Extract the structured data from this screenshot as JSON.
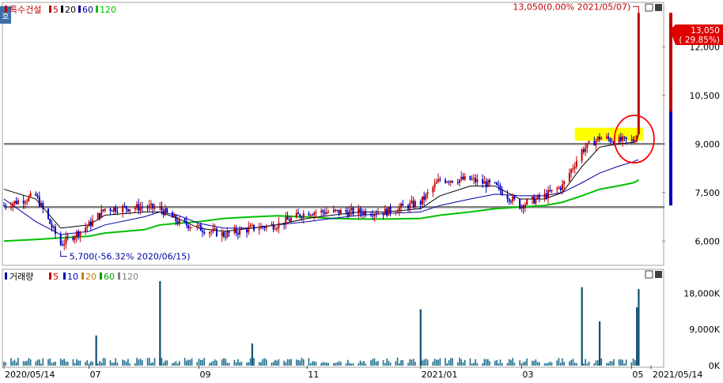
{
  "chart_data": [
    {
      "type": "candlestick",
      "title": "특수건설",
      "legend": [
        {
          "label": "특수건설",
          "color": "#c00000"
        },
        {
          "label": "5",
          "color": "#c00000"
        },
        {
          "label": "20",
          "color": "#000000"
        },
        {
          "label": "60",
          "color": "#0000a0"
        },
        {
          "label": "120",
          "color": "#00a000"
        }
      ],
      "ylim": [
        5300,
        13300
      ],
      "y_ticks": [
        6000,
        7500,
        9000,
        10500,
        12000
      ],
      "y_tick_labels": [
        "6,000",
        "7,500",
        "9,000",
        "10,500",
        "12,000"
      ],
      "horizontal_lines": [
        9000,
        7050
      ],
      "price_series": {
        "dates": [
          "2020-05-14",
          "2020-06-01",
          "2020-06-15",
          "2020-07-01",
          "2020-07-10",
          "2020-08-01",
          "2020-08-10",
          "2020-08-20",
          "2020-09-01",
          "2020-09-15",
          "2020-10-01",
          "2020-10-15",
          "2020-11-01",
          "2020-11-15",
          "2020-12-01",
          "2020-12-15",
          "2021-01-04",
          "2021-01-15",
          "2021-02-01",
          "2021-02-15",
          "2021-03-01",
          "2021-03-15",
          "2021-03-25",
          "2021-04-05",
          "2021-04-15",
          "2021-04-25",
          "2021-05-04",
          "2021-05-06",
          "2021-05-07"
        ],
        "close": [
          7100,
          7400,
          5900,
          6500,
          7000,
          7050,
          7000,
          6600,
          6400,
          6200,
          6400,
          6500,
          6900,
          6900,
          6900,
          6900,
          7200,
          7900,
          7900,
          7700,
          7100,
          7400,
          7700,
          8800,
          9200,
          9100,
          9100,
          9300,
          13050
        ]
      },
      "ma20": [
        7600,
        7300,
        6400,
        6500,
        6800,
        6900,
        6900,
        6700,
        6400,
        6300,
        6400,
        6500,
        6700,
        6800,
        6900,
        6900,
        7000,
        7400,
        7700,
        7700,
        7300,
        7300,
        7500,
        8300,
        8900,
        9000,
        9050,
        9100,
        9300
      ],
      "ma60": [
        7300,
        6600,
        6200,
        6300,
        6500,
        6750,
        6900,
        6800,
        6550,
        6400,
        6400,
        6500,
        6600,
        6700,
        6800,
        6850,
        6900,
        7100,
        7300,
        7450,
        7400,
        7400,
        7500,
        7800,
        8100,
        8300,
        8450,
        8500,
        8500
      ],
      "ma120": [
        6000,
        6050,
        6100,
        6150,
        6250,
        6350,
        6500,
        6550,
        6600,
        6700,
        6750,
        6780,
        6750,
        6700,
        6680,
        6680,
        6700,
        6800,
        6900,
        7000,
        7050,
        7100,
        7200,
        7400,
        7600,
        7700,
        7800,
        7850,
        7900
      ],
      "annotations": [
        {
          "text": "13,050(0.00% 2021/05/07)",
          "value": 13050,
          "date": "2021-05-07"
        },
        {
          "text": "5,700(-56.32% 2020/06/15)",
          "value": 5700,
          "date": "2020-06-15"
        }
      ],
      "last_price_badge": {
        "price": "13,050",
        "change": "( 29.85%)"
      },
      "highlight": {
        "type": "box",
        "from": "2021-04-01",
        "to": "2021-05-07",
        "ylow": 9100,
        "yhigh": 9500,
        "color": "#ffff00"
      },
      "callout": {
        "type": "circle",
        "around": "2021-05-01",
        "color": "#ff0000"
      }
    },
    {
      "type": "bar",
      "title": "거래량",
      "legend": [
        {
          "label": "거래량",
          "color": "#000000"
        },
        {
          "label": "5",
          "color": "#c00000"
        },
        {
          "label": "10",
          "color": "#0000c0"
        },
        {
          "label": "20",
          "color": "#c08000"
        },
        {
          "label": "60",
          "color": "#00a000"
        },
        {
          "label": "120",
          "color": "#808080"
        }
      ],
      "ylim": [
        0,
        21000
      ],
      "y_ticks": [
        0,
        9000,
        18000
      ],
      "y_tick_labels": [
        "0K",
        "9,000K",
        "18,000K"
      ],
      "spikes": [
        {
          "date": "2020-07-05",
          "value": 7500
        },
        {
          "date": "2020-08-10",
          "value": 22000
        },
        {
          "date": "2020-10-01",
          "value": 5500
        },
        {
          "date": "2021-01-04",
          "value": 14000
        },
        {
          "date": "2021-04-05",
          "value": 19500
        },
        {
          "date": "2021-04-15",
          "value": 11000
        },
        {
          "date": "2021-05-06",
          "value": 14500
        },
        {
          "date": "2021-05-07",
          "value": 19000
        }
      ],
      "baseline_volume": 1000
    }
  ],
  "x_axis": {
    "ticks": [
      "2020/05/14",
      "07",
      "09",
      "11",
      "2021/01",
      "03",
      "05",
      "2021/05/14"
    ],
    "tick_dates": [
      "2020-05-14",
      "2020-07-01",
      "2020-09-01",
      "2020-11-01",
      "2021-01-04",
      "2021-03-02",
      "2021-05-03",
      "2021-05-14"
    ]
  },
  "left_tab": "호",
  "colors": {
    "up": "#c00000",
    "down": "#0000c0",
    "ma5": "#c00000",
    "ma20": "#000000",
    "ma60": "#0000a0",
    "ma120": "#00c000",
    "badge": "#e00000",
    "hline": "#808080"
  }
}
